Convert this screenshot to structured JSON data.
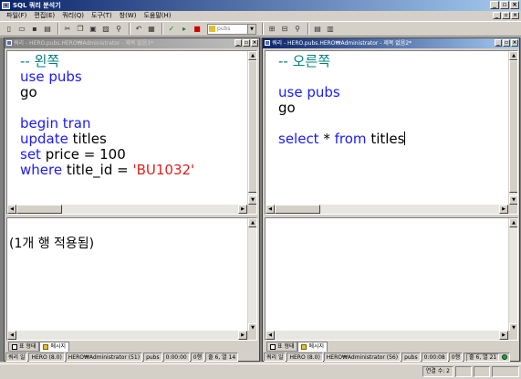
{
  "app": {
    "title": "SQL 쿼리 분석기"
  },
  "menu": [
    "파일(F)",
    "편집(E)",
    "쿼리(Q)",
    "도구(T)",
    "창(W)",
    "도움말(H)"
  ],
  "toolbar": {
    "database": "pubs"
  },
  "left_window": {
    "title": "쿼리 - HERO.pubs.HERO₩Administrator - 제목 없음1*",
    "code": {
      "l1": "-- 왼쪽",
      "l2": "use pubs",
      "l3": "go",
      "l4": "begin tran",
      "l5a": "update",
      "l5b": " titles",
      "l6a": "set",
      "l6b": " price = 100",
      "l7a": "where",
      "l7b": " title_id = ",
      "l7c": "'BU1032'"
    },
    "result_text": "(1개 행 적용됨)",
    "tabs": [
      "표 형태",
      "메시지"
    ],
    "status": [
      "쿼리 일",
      "HERO (8.0)",
      "HERO₩Administrator (51)",
      "pubs",
      "0:00:00",
      "0행",
      "줄 6, 열 14"
    ]
  },
  "right_window": {
    "title": "쿼리 - HERO.pubs.HERO₩Administrator - 제목 없음2*",
    "code": {
      "l1": "-- 오른쪽",
      "l2": "use pubs",
      "l3": "go",
      "l4a": "select",
      "l4b": " * ",
      "l4c": "from",
      "l4d": " titles"
    },
    "tabs": [
      "표 형태",
      "메시지"
    ],
    "status": [
      "쿼리 일",
      "HERO (8.0)",
      "HERO₩Administrator (56)",
      "pubs",
      "0:00:08",
      "0행",
      "줄 6, 열 21"
    ]
  },
  "statusbar": {
    "connections": "연결 수: 2"
  },
  "colors": {
    "keyword": "#1a1aff",
    "comment": "#008080",
    "string": "#e02020",
    "active_title": "#0a246a"
  }
}
